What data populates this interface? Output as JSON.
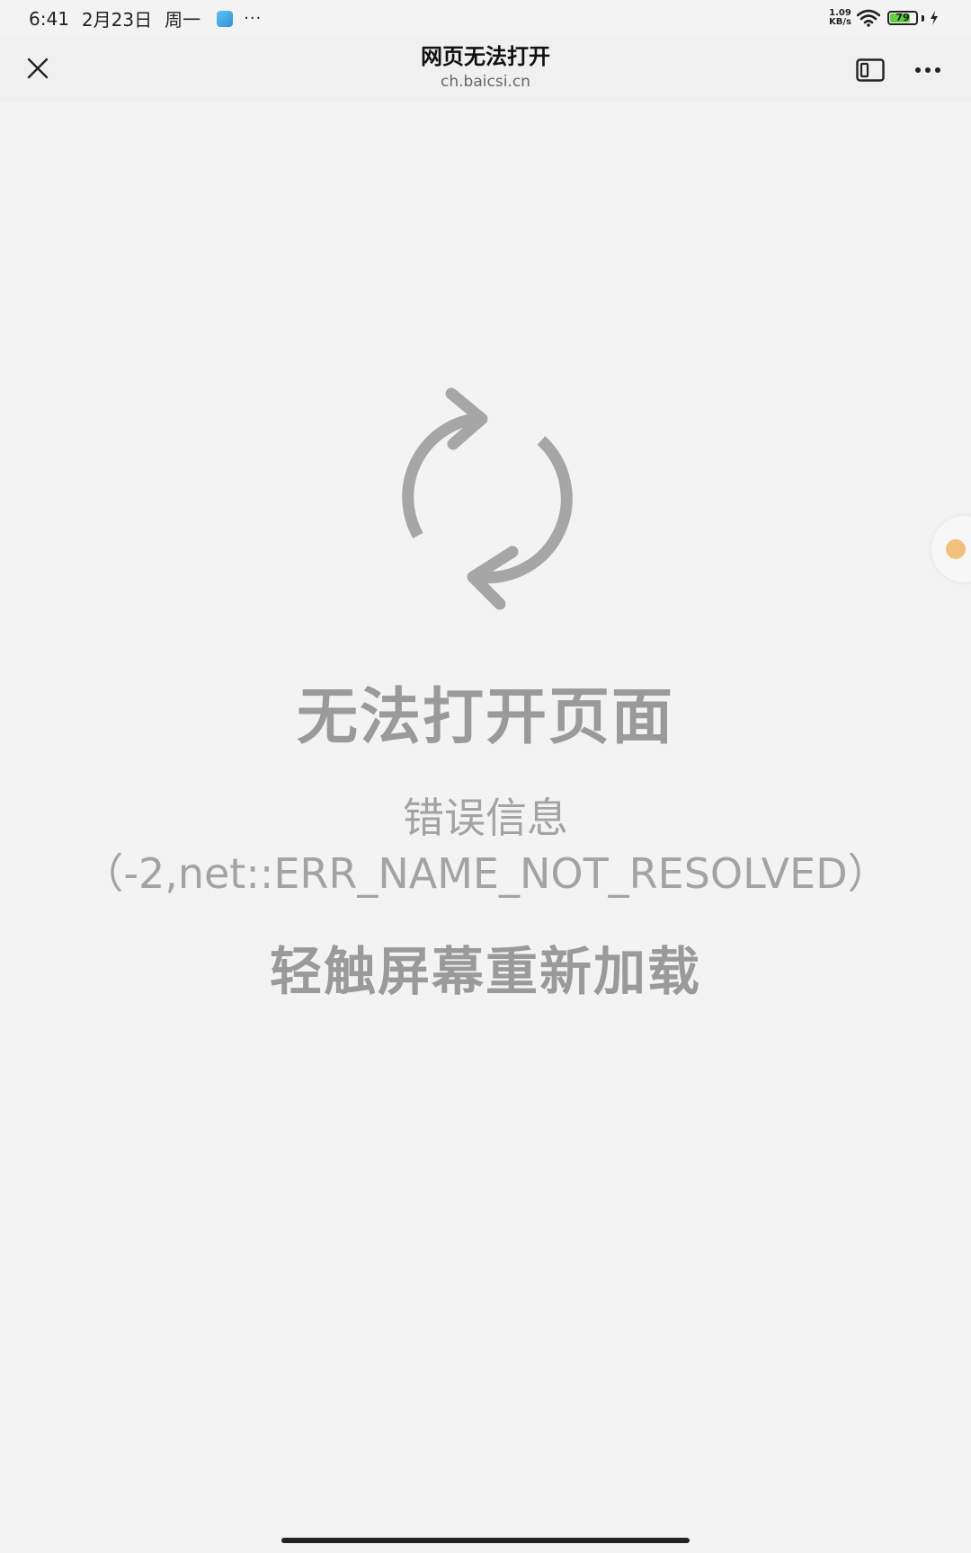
{
  "status_bar": {
    "time": "6:41",
    "date": "2月23日",
    "weekday": "周一",
    "more": "···",
    "net_speed_value": "1.09",
    "net_speed_unit": "KB/s",
    "battery_level": "79",
    "battery_fraction": 0.79,
    "battery_color": "#5fd13a",
    "icons": [
      "notification-app-icon",
      "wifi-icon",
      "battery-icon",
      "charging-icon"
    ]
  },
  "nav": {
    "title": "网页无法打开",
    "url": "ch.baicsi.cn",
    "icons": [
      "close-icon",
      "window-icon",
      "more-icon"
    ]
  },
  "error": {
    "title": "无法打开页面",
    "info_label": "错误信息",
    "code": "（-2,net::ERR_NAME_NOT_RESOLVED）",
    "reload_hint": "轻触屏幕重新加载",
    "icon": "refresh-icon",
    "text_color": "#9a9a9a"
  }
}
